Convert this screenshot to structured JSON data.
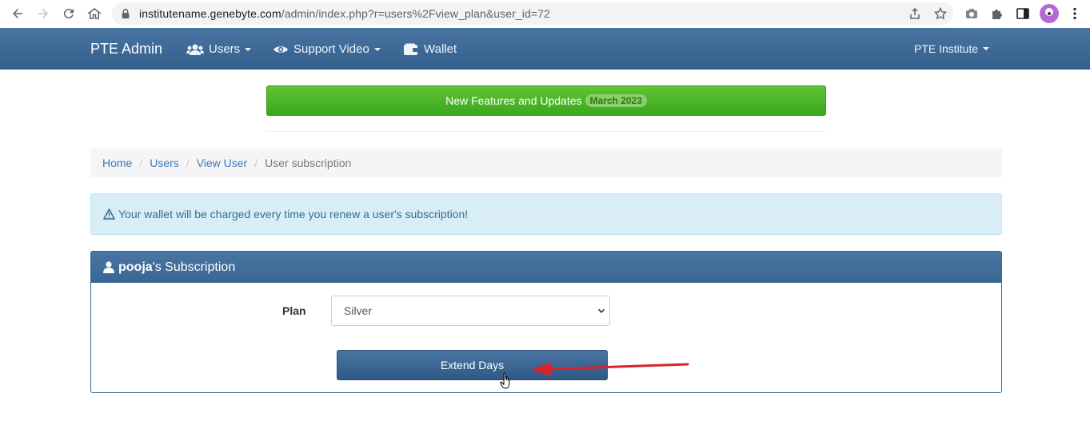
{
  "browser": {
    "url_host": "institutename.genebyte.com",
    "url_path": "/admin/index.php?r=users%2Fview_plan&user_id=72"
  },
  "navbar": {
    "brand": "PTE Admin",
    "items": [
      {
        "label": "Users",
        "icon": "users-icon"
      },
      {
        "label": "Support Video",
        "icon": "eye-icon"
      },
      {
        "label": "Wallet",
        "icon": "wallet-icon"
      }
    ],
    "account_label": "PTE Institute"
  },
  "announcement": {
    "label": "New Features and Updates",
    "badge": "March 2023",
    "color": "#4cb82a"
  },
  "breadcrumb": {
    "items": [
      "Home",
      "Users",
      "View User"
    ],
    "active": "User subscription"
  },
  "alert": {
    "icon": "warning-icon",
    "text": "Your wallet will be charged every time you renew a user's subscription!"
  },
  "subscription": {
    "user_name": "pooja",
    "title_suffix": "'s Subscription",
    "plan_label": "Plan",
    "plan_value": "Silver",
    "extend_label": "Extend Days"
  },
  "colors": {
    "primary": "#3b6795",
    "link": "#3d7ab8",
    "alert_bg": "#d9edf7",
    "annotation_arrow": "#d9232a"
  }
}
